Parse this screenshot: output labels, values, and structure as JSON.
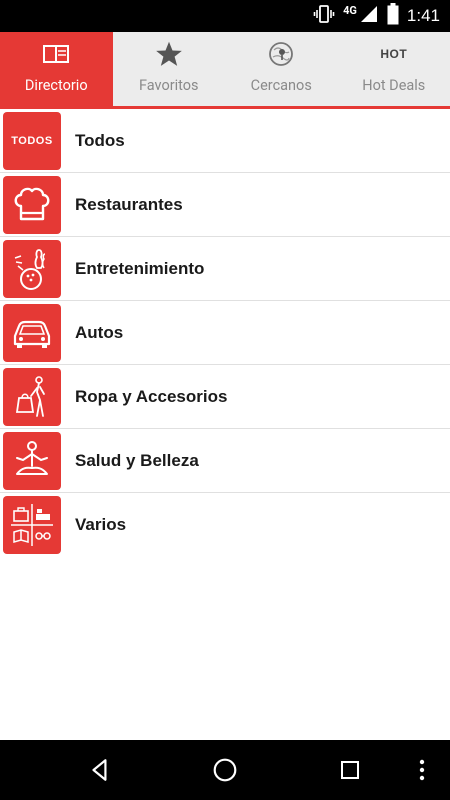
{
  "status_bar": {
    "network": "4G",
    "time": "1:41"
  },
  "tabs": [
    {
      "label": "Directorio",
      "icon": "directory-icon",
      "active": true
    },
    {
      "label": "Favoritos",
      "icon": "star-icon",
      "active": false
    },
    {
      "label": "Cercanos",
      "icon": "nearby-map-icon",
      "active": false
    },
    {
      "label": "Hot Deals",
      "icon": "hot-icon",
      "active": false,
      "icon_text": "HOT"
    }
  ],
  "categories": [
    {
      "label": "Todos",
      "icon": "todos-icon",
      "icon_text": "TODOS"
    },
    {
      "label": "Restaurantes",
      "icon": "chef-hat-icon"
    },
    {
      "label": "Entretenimiento",
      "icon": "bowling-icon"
    },
    {
      "label": "Autos",
      "icon": "car-icon"
    },
    {
      "label": "Ropa y Accesorios",
      "icon": "fashion-icon"
    },
    {
      "label": "Salud y Belleza",
      "icon": "yoga-icon"
    },
    {
      "label": "Varios",
      "icon": "misc-icon"
    }
  ],
  "colors": {
    "accent": "#e53935",
    "tab_bg": "#ececec",
    "status_bg": "#000000"
  }
}
